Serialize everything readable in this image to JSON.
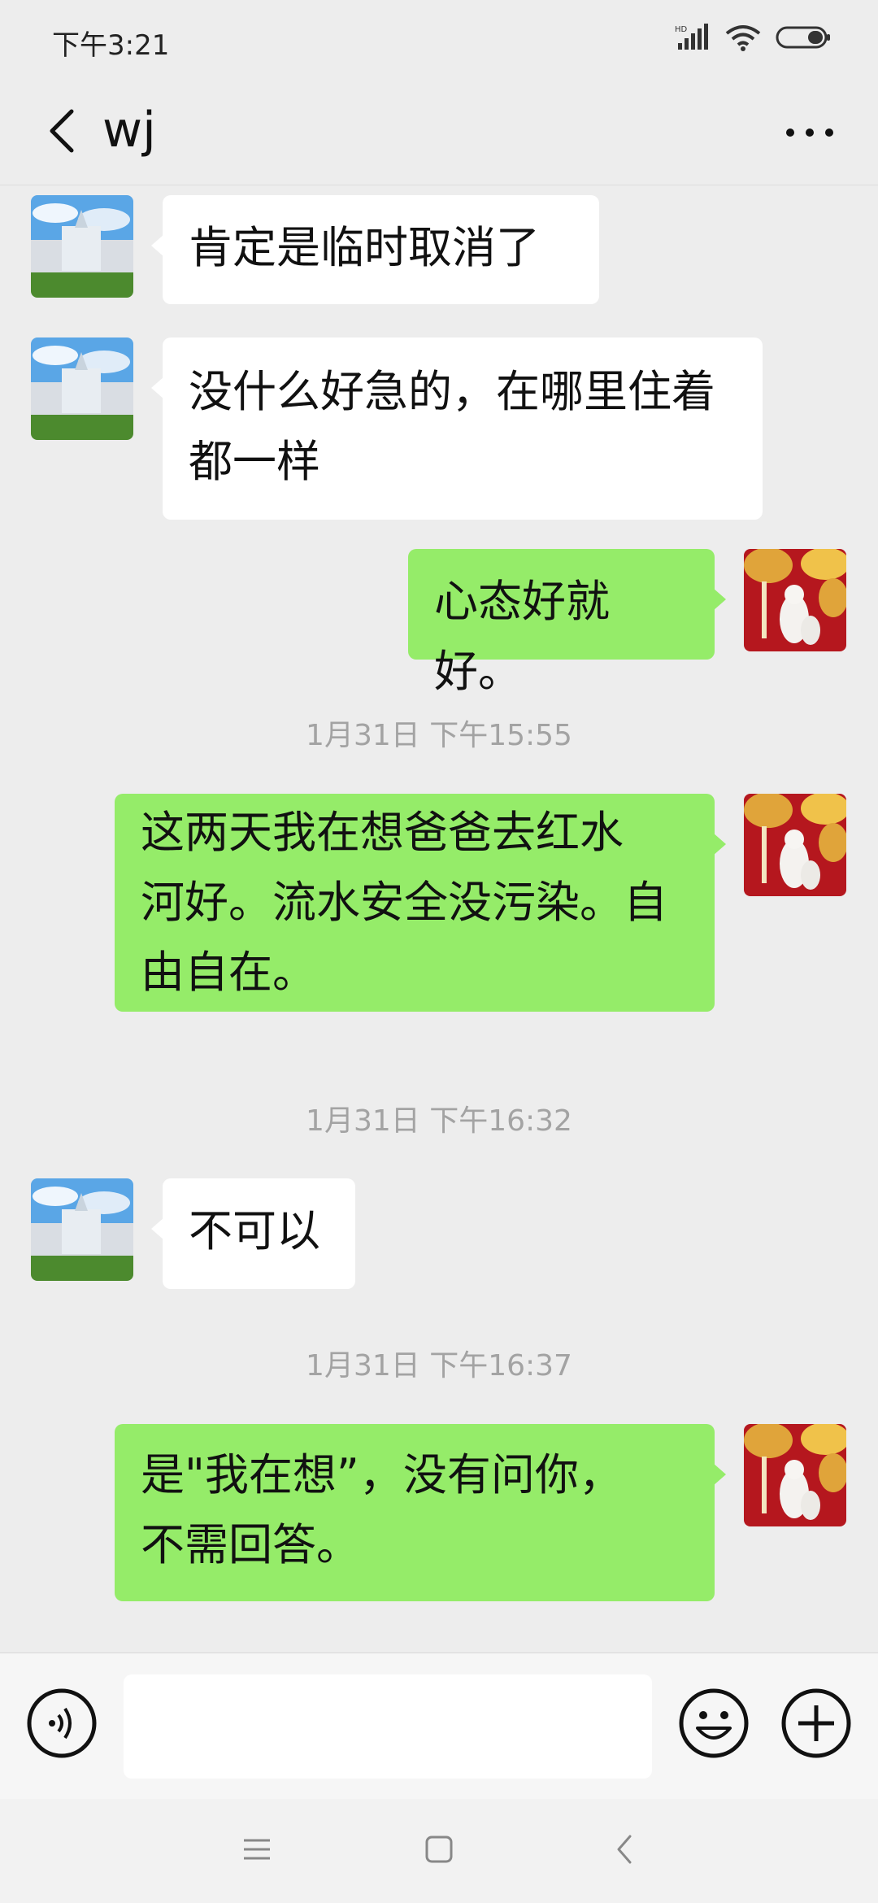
{
  "status_bar": {
    "time": "下午3:21",
    "icons": [
      "hd-signal-icon",
      "wifi-icon",
      "battery-icon"
    ]
  },
  "header": {
    "title": "wj",
    "back_icon": "back-arrow-icon",
    "more_icon": "more-dots-icon"
  },
  "messages": [
    {
      "type": "message",
      "direction": "in",
      "text": "肯定是临时取消了"
    },
    {
      "type": "message",
      "direction": "in",
      "text": "没什么好急的，在哪里住着\n都一样"
    },
    {
      "type": "message",
      "direction": "out",
      "text": "心态好就好。"
    },
    {
      "type": "timestamp",
      "text": "1月31日 下午15:55"
    },
    {
      "type": "message",
      "direction": "out",
      "text": "这两天我在想爸爸去红水\n河好。流水安全没污染。自\n由自在。"
    },
    {
      "type": "timestamp",
      "text": "1月31日 下午16:32"
    },
    {
      "type": "message",
      "direction": "in",
      "text": "不可以"
    },
    {
      "type": "timestamp",
      "text": "1月31日 下午16:37"
    },
    {
      "type": "message",
      "direction": "out",
      "text": "是\"我在想”，没有问你，\n不需回答。"
    }
  ],
  "input_bar": {
    "voice_icon": "voice-input-icon",
    "input_value": "",
    "emoji_icon": "emoji-icon",
    "plus_icon": "plus-icon"
  },
  "nav_bar": {
    "icons": [
      "menu-icon",
      "home-icon",
      "back-icon"
    ]
  },
  "colors": {
    "background": "#ededed",
    "outgoing_bubble": "#95ec69",
    "incoming_bubble": "#ffffff",
    "timestamp_text": "#a3a3a3"
  }
}
